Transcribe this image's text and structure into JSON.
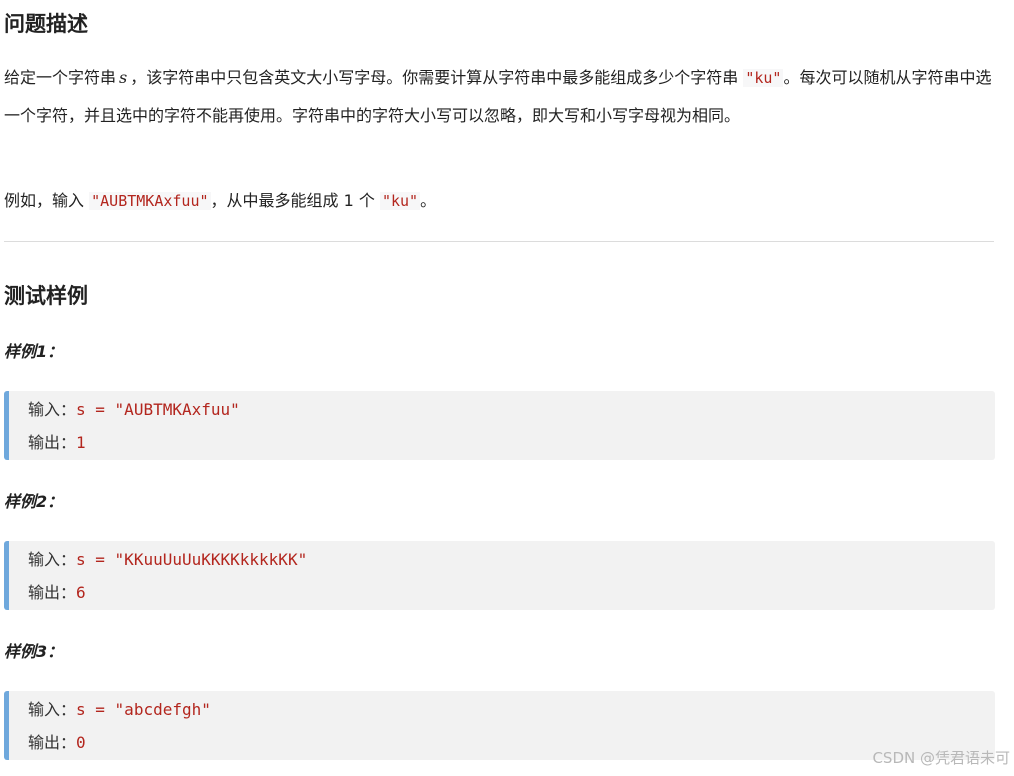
{
  "description": {
    "title": "问题描述",
    "para_part1": "给定一个字符串",
    "var": "s",
    "para_part2": "，该字符串中只包含英文大小写字母。你需要计算从字符串中最多能组成多少个字符串",
    "target_code": "\"ku\"",
    "para_part3": "。每次可以随机从字符串中选一个字符，并且选中的字符不能再使用。字符串中的字符大小写可以忽略，即大写和小写字母视为相同。",
    "example_part1": "例如，输入",
    "example_input_code": "\"AUBTMKAxfuu\"",
    "example_part2": "，从中最多能组成 1 个",
    "example_target_code": "\"ku\"",
    "example_part3": "。"
  },
  "tests": {
    "title": "测试样例",
    "samples": [
      {
        "label": "样例1：",
        "input_label": "输入：",
        "input_code": "s = \"AUBTMKAxfuu\"",
        "output_label": "输出：",
        "output_code": "1"
      },
      {
        "label": "样例2：",
        "input_label": "输入：",
        "input_code": "s = \"KKuuUuUuKKKKkkkkKK\"",
        "output_label": "输出：",
        "output_code": "6"
      },
      {
        "label": "样例3：",
        "input_label": "输入：",
        "input_code": "s = \"abcdefgh\"",
        "output_label": "输出：",
        "output_code": "0"
      }
    ]
  },
  "watermark": "CSDN @凭君语未可",
  "colors": {
    "code_red": "#b3261e",
    "box_border_blue": "#6fa8dc",
    "box_bg": "#f2f2f2"
  }
}
